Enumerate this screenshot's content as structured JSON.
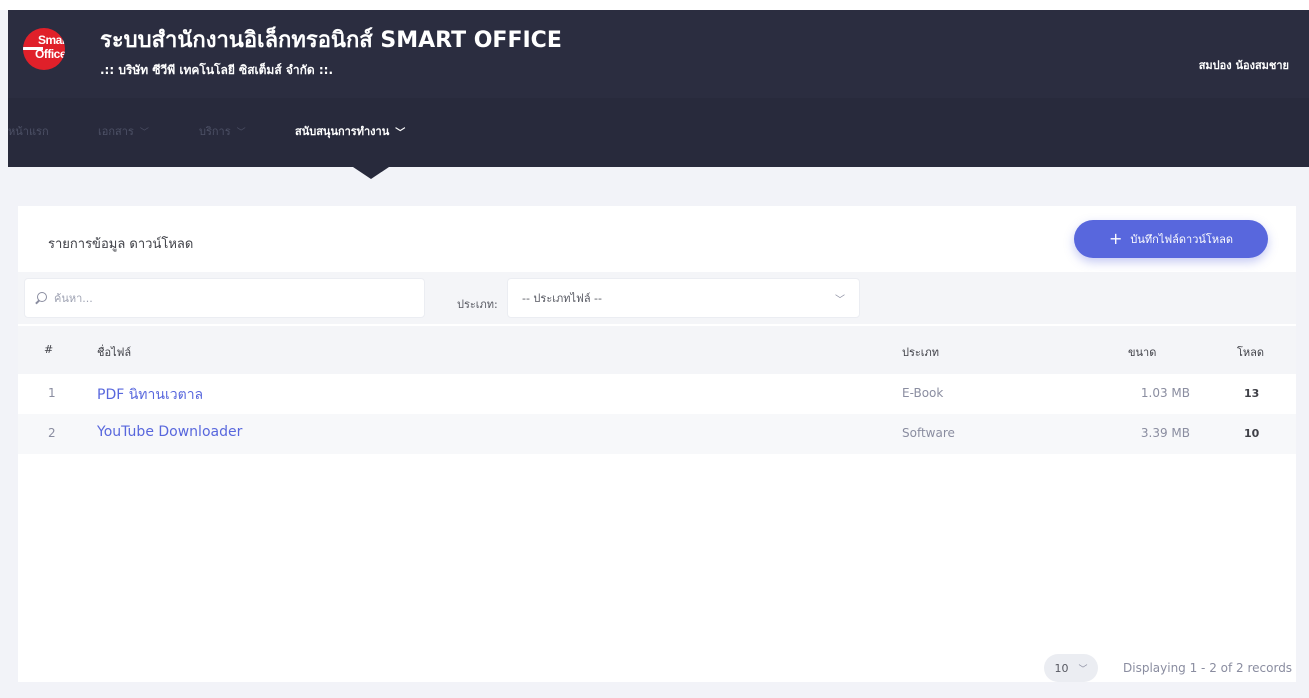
{
  "header": {
    "logo_text_top": "Smart",
    "logo_text_bottom": "Office",
    "title": "ระบบสำนักงานอิเล็กทรอนิกส์ SMART OFFICE",
    "subtitle": ".:: บริษัท ซีวีพี เทคโนโลยี ซิสเต็มส์ จำกัด ::.",
    "user_name": "สมปอง น้องสมชาย"
  },
  "nav": {
    "items": [
      {
        "label": "หน้าแรก",
        "has_dropdown": false,
        "active": false
      },
      {
        "label": "เอกสาร",
        "has_dropdown": true,
        "active": false
      },
      {
        "label": "บริการ",
        "has_dropdown": true,
        "active": false
      },
      {
        "label": "สนับสนุนการทำงาน",
        "has_dropdown": true,
        "active": true
      }
    ]
  },
  "page": {
    "title": "รายการข้อมูล ดาวน์โหลด",
    "add_button_label": "บันทึกไฟล์ดาวน์โหลด"
  },
  "filters": {
    "search_placeholder": "ค้นหา...",
    "search_value": "",
    "type_label": "ประเภท:",
    "type_selected": "-- ประเภทไฟล์ --"
  },
  "table": {
    "columns": [
      "#",
      "ชื่อไฟล์",
      "ประเภท",
      "ขนาด",
      "โหลด"
    ],
    "rows": [
      {
        "num": "1",
        "name": "PDF นิทานเวตาล",
        "type": "E-Book",
        "size": "1.03 MB",
        "downloads": "13"
      },
      {
        "num": "2",
        "name": "YouTube Downloader",
        "type": "Software",
        "size": "3.39 MB",
        "downloads": "10"
      }
    ]
  },
  "pagination": {
    "page_size": "10",
    "info": "Displaying 1 - 2 of 2 records"
  },
  "colors": {
    "header_bg": "#282a3c",
    "accent": "#5867dd",
    "logo_red": "#e0202a"
  }
}
